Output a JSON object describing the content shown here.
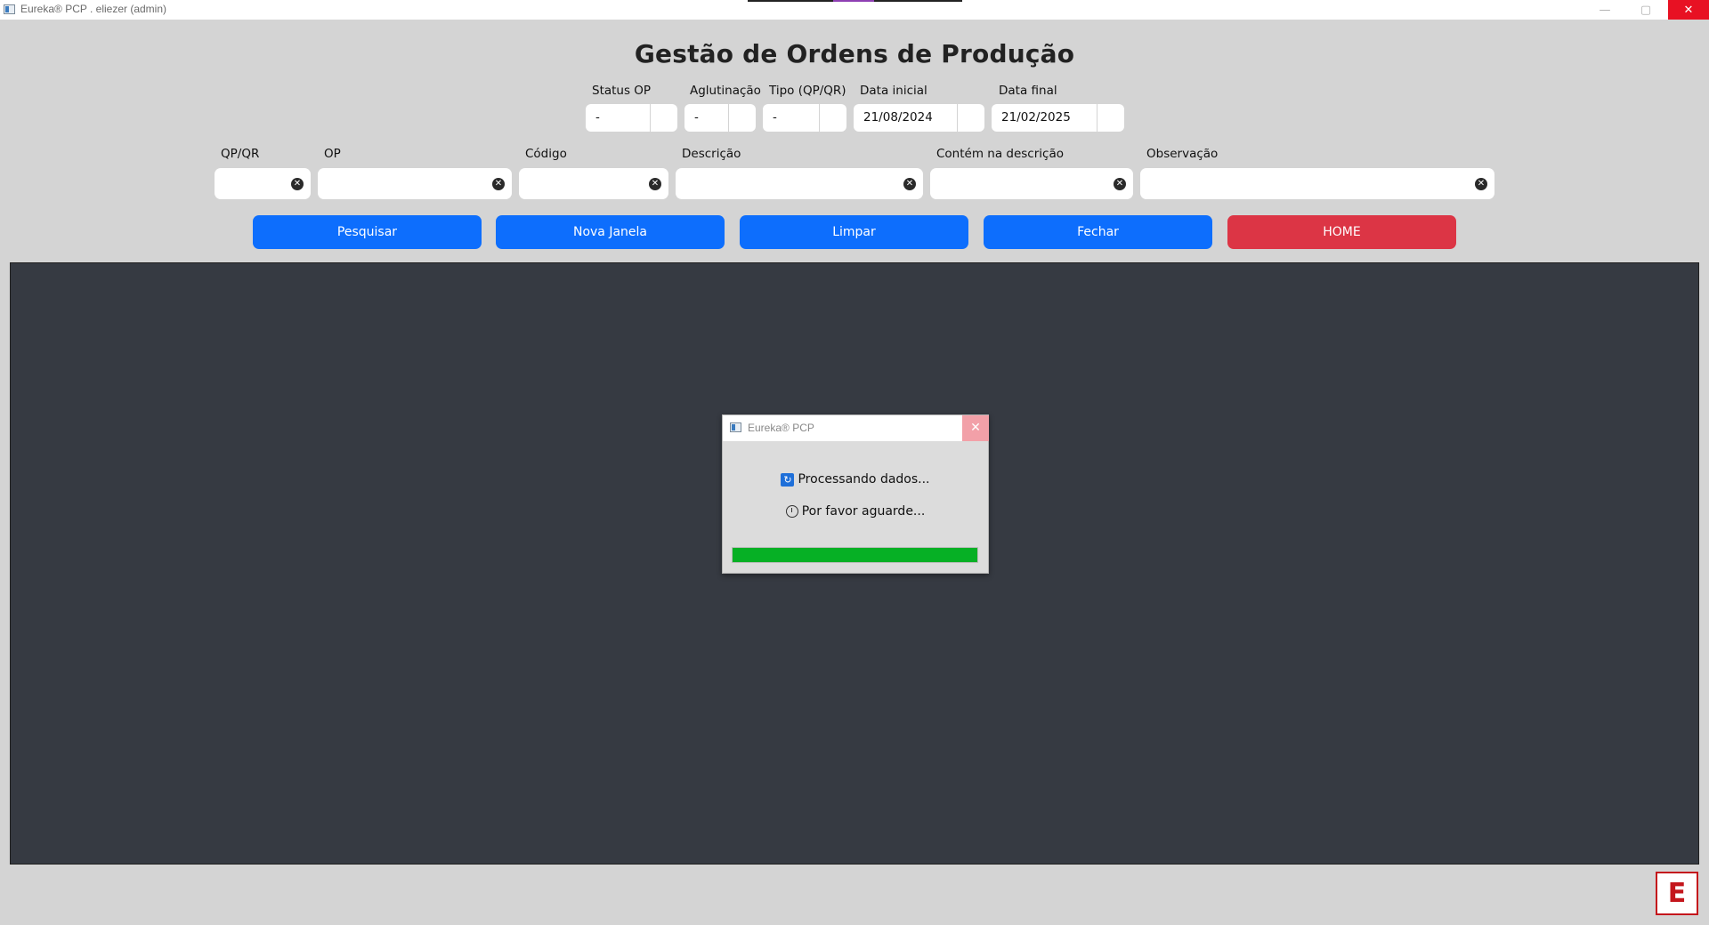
{
  "window": {
    "title": "Eureka® PCP . eliezer (admin)",
    "min_symbol": "—",
    "max_symbol": "▢",
    "close_symbol": "✕"
  },
  "page": {
    "title": "Gestão de Ordens de Produção"
  },
  "filters_row1": [
    {
      "label": "Status OP",
      "value": "-"
    },
    {
      "label": "Aglutinação",
      "value": "-"
    },
    {
      "label": "Tipo (QP/QR)",
      "value": "-"
    },
    {
      "label": "Data inicial",
      "value": "21/08/2024"
    },
    {
      "label": "Data final",
      "value": "21/02/2025"
    }
  ],
  "filters_row2": [
    {
      "label": "QP/QR",
      "value": ""
    },
    {
      "label": "OP",
      "value": ""
    },
    {
      "label": "Código",
      "value": ""
    },
    {
      "label": "Descrição",
      "value": ""
    },
    {
      "label": "Contém na descrição",
      "value": ""
    },
    {
      "label": "Observação",
      "value": ""
    }
  ],
  "clear_symbol": "✕",
  "buttons": {
    "search": "Pesquisar",
    "new_window": "Nova Janela",
    "clear": "Limpar",
    "close": "Fechar",
    "home": "HOME"
  },
  "colors": {
    "primary": "#0d6efd",
    "danger": "#dc3545",
    "results_bg": "#363a42",
    "progress": "#06b025",
    "logo": "#c4161c"
  },
  "dialog": {
    "title": "Eureka® PCP",
    "close_symbol": "✕",
    "line1": "Processando dados...",
    "line2": "Por favor aguarde...",
    "refresh_icon": "↻",
    "progress_fraction": 1.0
  },
  "logo": {
    "letter": "E"
  }
}
